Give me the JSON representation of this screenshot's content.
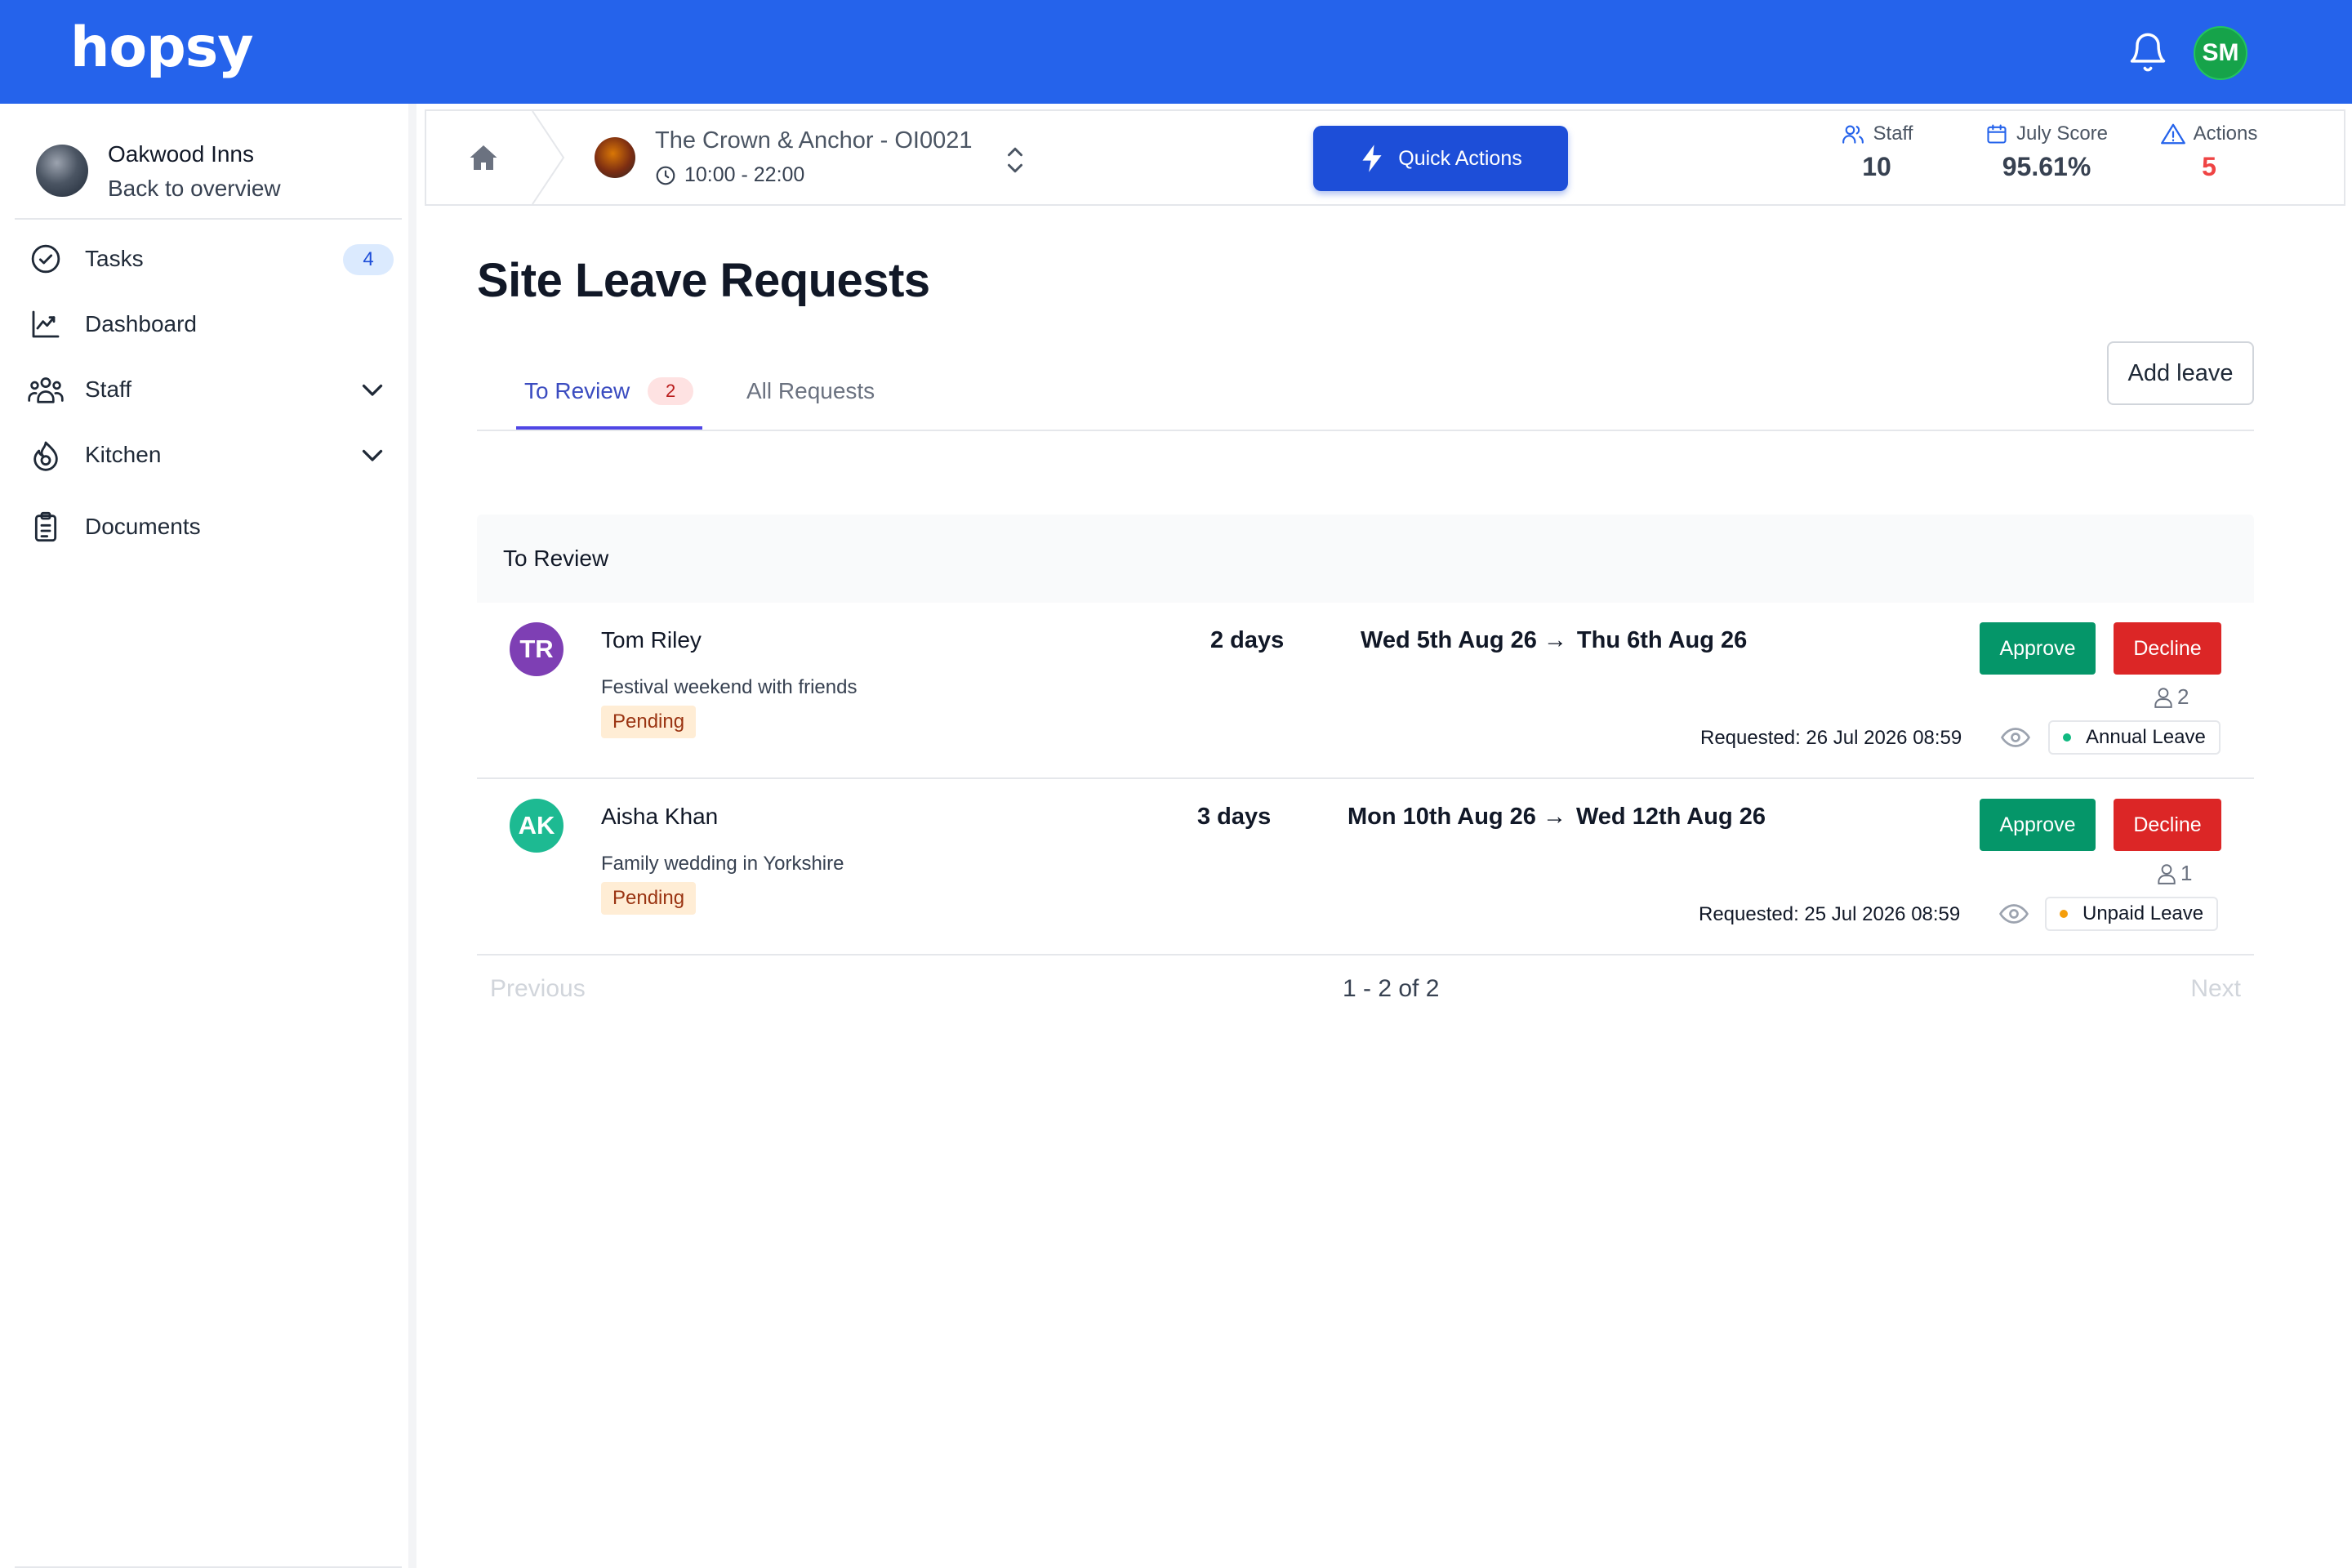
{
  "app": {
    "logo": "hopsy",
    "user_initials": "SM"
  },
  "sidebar": {
    "org_name": "Oakwood Inns",
    "back_label": "Back to overview",
    "items": [
      {
        "label": "Tasks",
        "icon": "check-circle-icon",
        "badge": "4"
      },
      {
        "label": "Dashboard",
        "icon": "chart-line-icon"
      },
      {
        "label": "Staff",
        "icon": "users-icon",
        "expandable": true
      },
      {
        "label": "Kitchen",
        "icon": "flame-icon",
        "expandable": true
      },
      {
        "label": "Documents",
        "icon": "clipboard-icon"
      }
    ]
  },
  "subheader": {
    "site_name": "The Crown & Anchor - OI0021",
    "site_hours": "10:00 - 22:00",
    "quick_actions_label": "Quick Actions",
    "stats": [
      {
        "label": "Staff",
        "value": "10",
        "icon": "users-icon"
      },
      {
        "label": "July Score",
        "value": "95.61%",
        "icon": "calendar-icon"
      },
      {
        "label": "Actions",
        "value": "5",
        "icon": "warning-icon",
        "color": "#ef4444"
      }
    ]
  },
  "main": {
    "title": "Site Leave Requests",
    "tabs": [
      {
        "label": "To Review",
        "badge": "2",
        "active": true
      },
      {
        "label": "All Requests"
      }
    ],
    "add_leave_label": "Add leave",
    "panel_title": "To Review",
    "requests": [
      {
        "initials": "TR",
        "avatar_color": "#7e3fb4",
        "name": "Tom Riley",
        "reason": "Festival weekend with friends",
        "status": "Pending",
        "days": "2 days",
        "start": "Wed 5th Aug 26",
        "end": "Thu 6th Aug 26",
        "approve_label": "Approve",
        "decline_label": "Decline",
        "count": "2",
        "requested": "Requested: 26 Jul 2026 08:59",
        "leave_type": "Annual Leave",
        "leave_type_color": "#10b981"
      },
      {
        "initials": "AK",
        "avatar_color": "#1dba92",
        "name": "Aisha Khan",
        "reason": "Family wedding in Yorkshire",
        "status": "Pending",
        "days": "3 days",
        "start": "Mon 10th Aug 26",
        "end": "Wed 12th Aug 26",
        "approve_label": "Approve",
        "decline_label": "Decline",
        "count": "1",
        "requested": "Requested: 25 Jul 2026 08:59",
        "leave_type": "Unpaid Leave",
        "leave_type_color": "#f59e0b"
      }
    ],
    "pagination": {
      "previous": "Previous",
      "summary": "1 - 2 of 2",
      "next": "Next"
    }
  },
  "colors": {
    "brand": "#2563eb",
    "approve": "#059669",
    "decline": "#dc2626",
    "tab_active": "#4f46e5"
  }
}
